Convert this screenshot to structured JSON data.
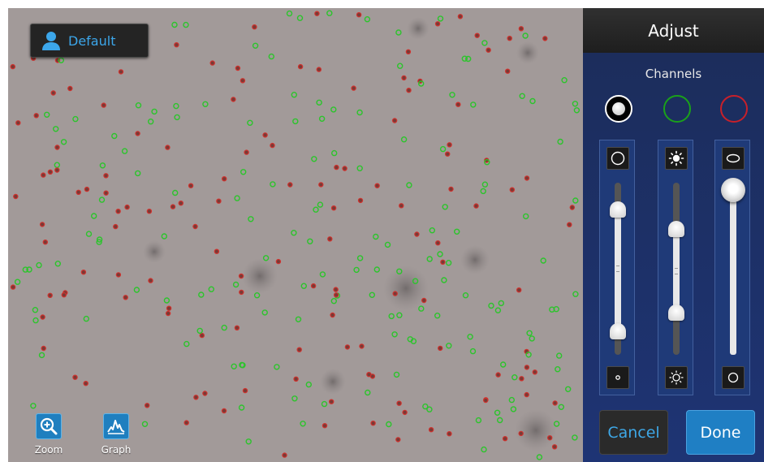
{
  "profile": {
    "label": "Default",
    "icon": "user-icon"
  },
  "toolbar": [
    {
      "label": "Zoom",
      "icon": "zoom-in-icon"
    },
    {
      "label": "Graph",
      "icon": "graph-icon"
    }
  ],
  "panel": {
    "title": "Adjust",
    "channels_label": "Channels",
    "channels": [
      {
        "name": "white",
        "color": "#ffffff",
        "selected": true
      },
      {
        "name": "green",
        "color": "#1aa11a",
        "selected": false
      },
      {
        "name": "red",
        "color": "#c8202a",
        "selected": false
      }
    ],
    "sliders": [
      {
        "top_icon": "circle-outline-icon",
        "bottom_icon": "small-dot-icon",
        "range": [
          0.12,
          0.86
        ]
      },
      {
        "top_icon": "brightness-high-icon",
        "bottom_icon": "brightness-low-icon",
        "range": [
          0.29,
          0.75
        ]
      },
      {
        "top_icon": "ellipse-icon",
        "bottom_icon": "circle-outline-icon",
        "value": 0.0
      }
    ],
    "cancel_label": "Cancel",
    "done_label": "Done"
  },
  "colors": {
    "panel_bg": "#1b2e62",
    "accent": "#3ca6ea",
    "green_cell": "#2cc42c",
    "red_cell": "#d0322e"
  }
}
